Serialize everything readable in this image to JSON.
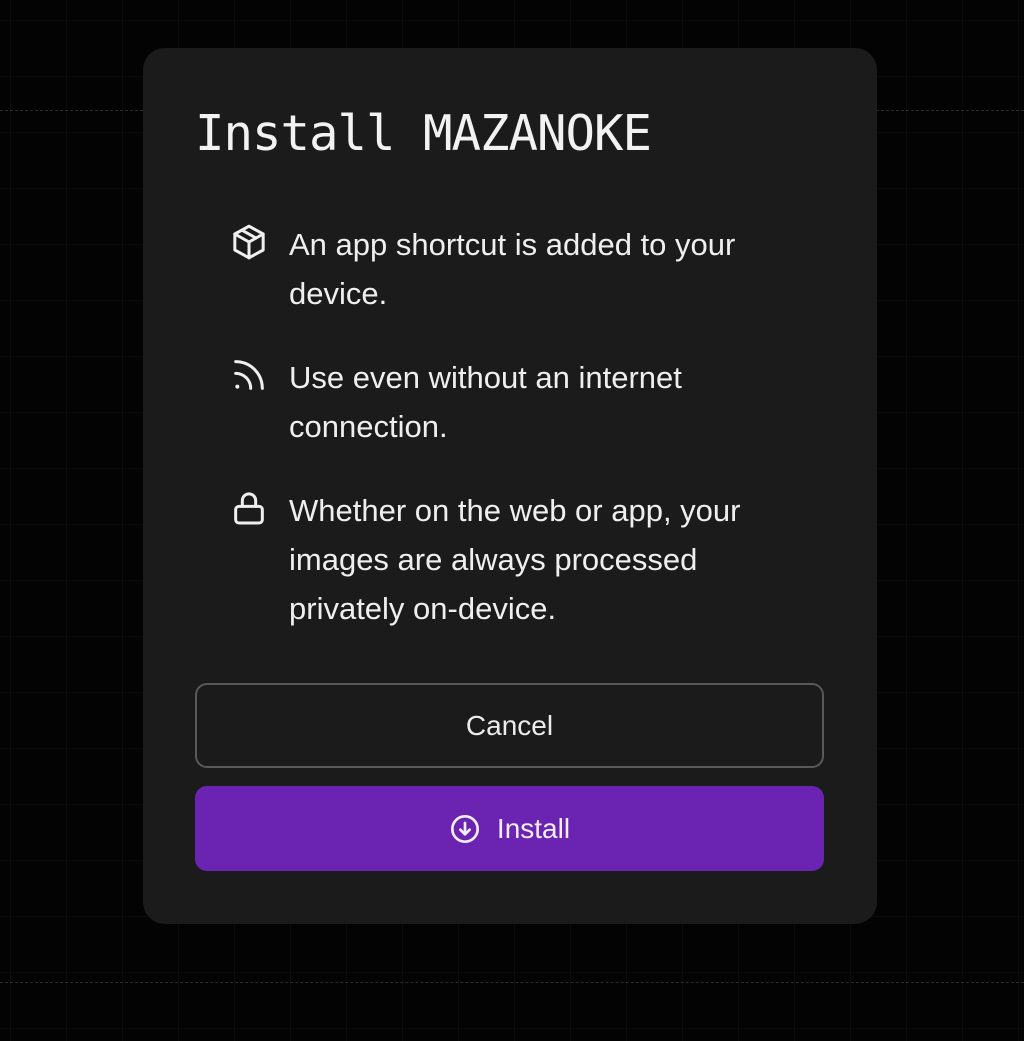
{
  "dialog": {
    "title": "Install MAZANOKE",
    "features": [
      {
        "icon": "package-icon",
        "text": "An app shortcut is added to your device."
      },
      {
        "icon": "rss-icon",
        "text": "Use even without an internet connection."
      },
      {
        "icon": "lock-icon",
        "text": "Whether on the web or app, your images are always processed privately on-device."
      }
    ],
    "cancel_label": "Cancel",
    "install_label": "Install",
    "install_icon": "download-circle-icon"
  },
  "colors": {
    "background": "#000000",
    "dialog_background": "#1b1b1b",
    "primary_button": "#6b24b2",
    "text": "#efefef",
    "cancel_border": "#595959"
  }
}
